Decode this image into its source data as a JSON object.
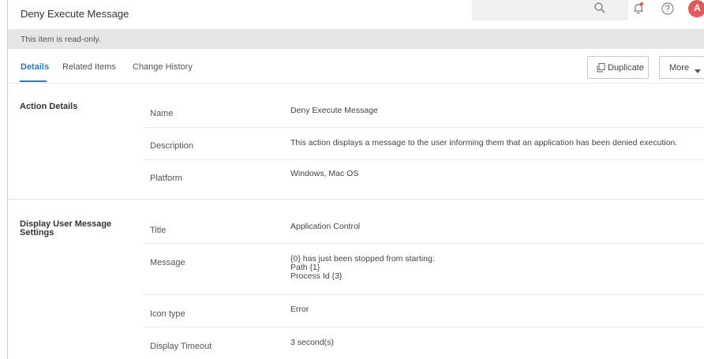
{
  "header": {
    "title": "Deny Execute Message",
    "avatar_initial": "A",
    "icons": [
      "search-icon",
      "bell-icon",
      "help-icon"
    ]
  },
  "banner": {
    "text": "This item is read-only."
  },
  "tabs": [
    {
      "label": "Details",
      "active": true
    },
    {
      "label": "Related Items",
      "active": false
    },
    {
      "label": "Change History",
      "active": false
    }
  ],
  "toolbar": {
    "duplicate_label": "Duplicate",
    "more_label": "More"
  },
  "sections": {
    "action_details": {
      "title": "Action Details",
      "rows": [
        {
          "label": "Name",
          "value": "Deny Execute Message"
        },
        {
          "label": "Description",
          "value": "This action displays a message to the user informing them that an application has been denied execution."
        },
        {
          "label": "Platform",
          "value": "Windows, Mac OS"
        }
      ]
    },
    "display_settings": {
      "title": "Display User Message Settings",
      "rows": [
        {
          "label": "Title",
          "value": "Application Control"
        },
        {
          "label": "Message",
          "value_lines": [
            "{0} has just been stopped from starting:",
            "Path {1}",
            "Process Id {3}"
          ]
        },
        {
          "label": "Icon type",
          "value": "Error"
        },
        {
          "label": "Display Timeout",
          "value": "3 second(s)"
        }
      ]
    }
  },
  "colors": {
    "accent": "#2a7bbf",
    "banner_bg": "#e6e6e6",
    "avatar_bg": "#e35a5a"
  }
}
